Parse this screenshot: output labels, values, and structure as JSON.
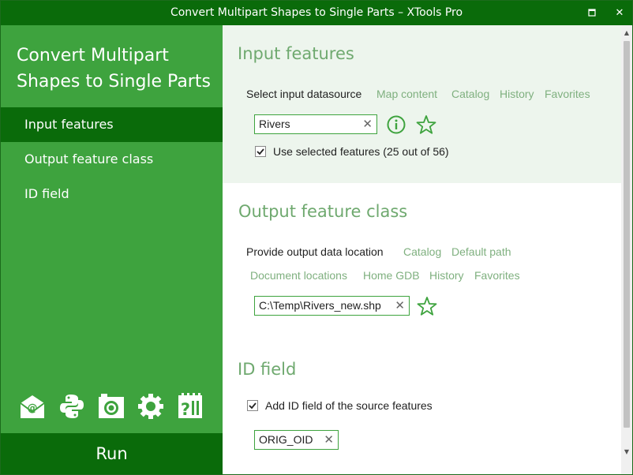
{
  "window": {
    "title": "Convert Multipart Shapes to Single Parts – XTools Pro",
    "maximize_glyph": "▫",
    "close_glyph": "✕"
  },
  "sidebar": {
    "tool_title": "Convert Multipart Shapes to Single Parts",
    "nav": [
      {
        "label": "Input features",
        "active": true
      },
      {
        "label": "Output feature class",
        "active": false
      },
      {
        "label": "ID field",
        "active": false
      }
    ],
    "tool_icons": [
      "email-icon",
      "python-icon",
      "camera-icon",
      "gear-icon",
      "help-icon"
    ],
    "run_label": "Run"
  },
  "input_section": {
    "title": "Input features",
    "select_label": "Select input datasource",
    "links": [
      "Map content",
      "Catalog",
      "History",
      "Favorites"
    ],
    "value": "Rivers",
    "use_selected": {
      "checked": true,
      "label": "Use selected features (25 out of 56)"
    }
  },
  "output_section": {
    "title": "Output feature class",
    "provide_label": "Provide output data location",
    "links_row1": [
      "Catalog",
      "Default path"
    ],
    "links_row2": [
      "Document locations",
      "Home GDB",
      "History",
      "Favorites"
    ],
    "value": "C:\\Temp\\Rivers_new.shp"
  },
  "id_section": {
    "title": "ID field",
    "add_id": {
      "checked": true,
      "label": "Add ID field of the source features"
    },
    "value": "ORIG_OID"
  },
  "colors": {
    "dark_green": "#0a6b0a",
    "sidebar_green": "#3ea33e",
    "accent": "#3ea33e",
    "link": "#7fb07f",
    "section_title": "#6fa96f"
  }
}
